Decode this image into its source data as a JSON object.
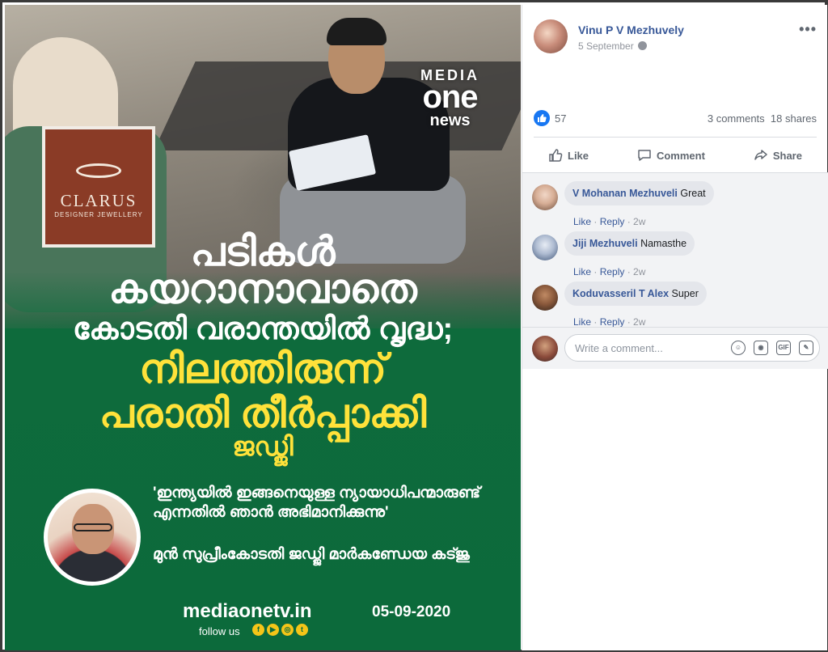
{
  "post_image": {
    "logo_clarus": "CLARUS",
    "logo_clarus_sub": "DESIGNER JEWELLERY",
    "channel_logo": {
      "line1": "MEDIA",
      "line2": "one",
      "line3": "news"
    },
    "headline_lines": [
      "പടികൾ",
      "കയറാനാവാതെ",
      "കോടതി വരാന്തയിൽ വൃദ്ധ;",
      "നിലത്തിരുന്ന്",
      "പരാതി തീർപ്പാക്കി",
      "ജഡ്ജി"
    ],
    "quote": "'ഇന്ത്യയിൽ ഇങ്ങനെയുള്ള ന്യായാധിപന്മാരുണ്ട് എന്നതിൽ ഞാൻ അഭിമാനിക്കുന്നു'",
    "quote_source": "മുൻ സുപ്രീംകോടതി ജഡ്ജി മാർകണ്ഡേയ കട്ജു",
    "website": "mediaonetv.in",
    "image_date": "05-09-2020",
    "follow_us": "follow us",
    "social_icons": [
      "f",
      "▶",
      "◎",
      "t"
    ]
  },
  "post": {
    "author": "Vinu P V Mezhuvely",
    "date": "5 September",
    "more_icon": "•••",
    "reaction_count": "57",
    "comments_count": "3 comments",
    "shares_count": "18 shares",
    "actions": {
      "like": "Like",
      "comment": "Comment",
      "share": "Share"
    }
  },
  "comments": [
    {
      "author": "V Mohanan Mezhuveli",
      "text": "Great",
      "like": "Like",
      "reply": "Reply",
      "age": "2w",
      "avatar_color": "#f1d7c7"
    },
    {
      "author": "Jiji Mezhuveli",
      "text": "Namasthe",
      "like": "Like",
      "reply": "Reply",
      "age": "2w",
      "avatar_color": "#c7d3e6"
    },
    {
      "author": "Koduvasseril T Alex",
      "text": "Super",
      "like": "Like",
      "reply": "Reply",
      "age": "2w",
      "avatar_color": "#8b5a3c"
    }
  ],
  "composer": {
    "placeholder": "Write a comment...",
    "icons": [
      "emoji-icon",
      "camera-icon",
      "gif-icon",
      "sticker-icon"
    ],
    "gif_label": "GIF"
  },
  "colors": {
    "fb_blue": "#385898",
    "green_bg": "#0e6b3c",
    "headline_yellow": "#ffe23a",
    "like_blue": "#1877f2"
  }
}
